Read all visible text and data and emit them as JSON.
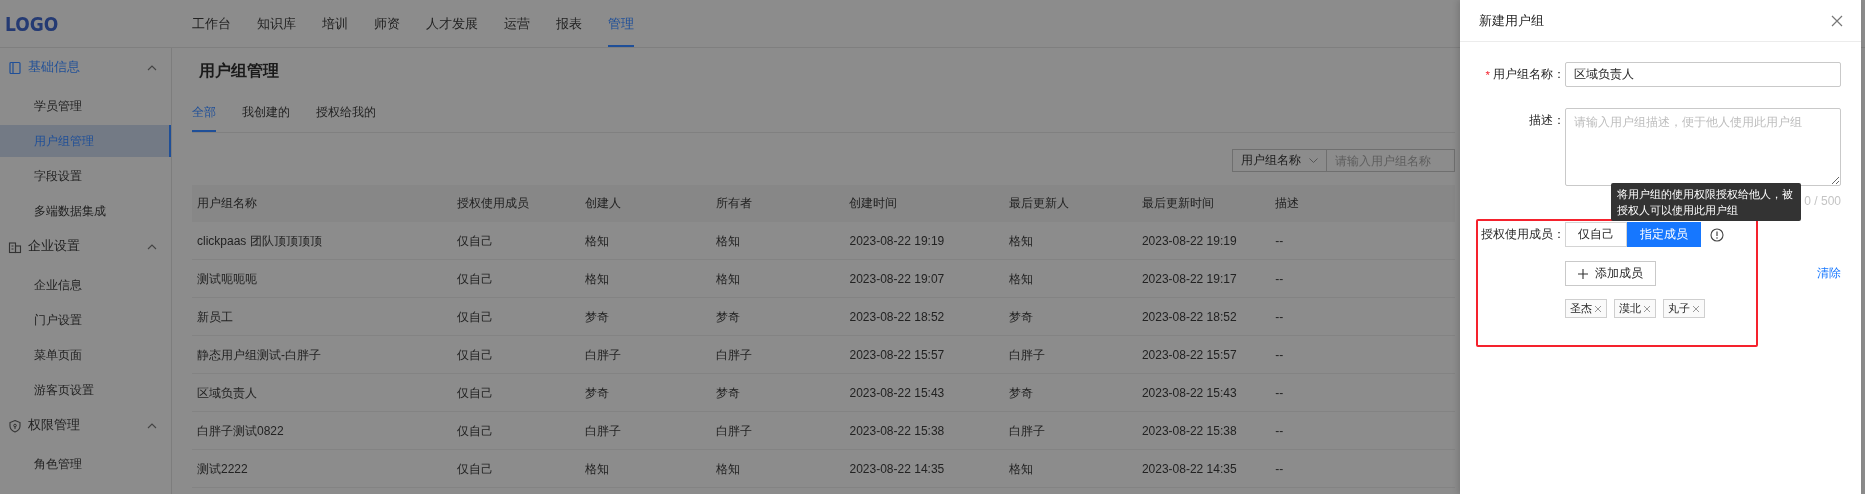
{
  "header": {
    "logo": "LOGO",
    "nav": [
      {
        "label": "工作台",
        "selected": false
      },
      {
        "label": "知识库",
        "selected": false
      },
      {
        "label": "培训",
        "selected": false
      },
      {
        "label": "师资",
        "selected": false
      },
      {
        "label": "人才发展",
        "selected": false
      },
      {
        "label": "运营",
        "selected": false
      },
      {
        "label": "报表",
        "selected": false
      },
      {
        "label": "管理",
        "selected": true
      }
    ]
  },
  "sidebar": {
    "groups": [
      {
        "label": "基础信息",
        "kind": "book",
        "active": true,
        "expanded": true,
        "children": [
          {
            "label": "学员管理",
            "selected": false
          },
          {
            "label": "用户组管理",
            "selected": true
          },
          {
            "label": "字段设置",
            "selected": false
          },
          {
            "label": "多端数据集成",
            "selected": false
          }
        ]
      },
      {
        "label": "企业设置",
        "kind": "building",
        "active": false,
        "expanded": true,
        "children": [
          {
            "label": "企业信息",
            "selected": false
          },
          {
            "label": "门户设置",
            "selected": false
          },
          {
            "label": "菜单页面",
            "selected": false
          },
          {
            "label": "游客页设置",
            "selected": false
          }
        ]
      },
      {
        "label": "权限管理",
        "kind": "shield",
        "active": false,
        "expanded": true,
        "children": [
          {
            "label": "角色管理",
            "selected": false
          }
        ]
      }
    ]
  },
  "page": {
    "title": "用户组管理",
    "tabs": [
      {
        "label": "全部",
        "selected": true
      },
      {
        "label": "我创建的",
        "selected": false
      },
      {
        "label": "授权给我的",
        "selected": false
      }
    ],
    "filter": {
      "field": "用户组名称",
      "placeholder": "请输入用户组名称"
    },
    "table": {
      "columns": [
        "用户组名称",
        "授权使用成员",
        "创建人",
        "所有者",
        "创建时间",
        "最后更新人",
        "最后更新时间",
        "描述"
      ],
      "rows": [
        [
          "clickpaas 团队顶顶顶顶",
          "仅自己",
          "格知",
          "格知",
          "2023-08-22 19:19",
          "格知",
          "2023-08-22 19:19",
          "--"
        ],
        [
          "测试呃呃呃",
          "仅自己",
          "格知",
          "格知",
          "2023-08-22 19:07",
          "格知",
          "2023-08-22 19:17",
          "--"
        ],
        [
          "新员工",
          "仅自己",
          "梦奇",
          "梦奇",
          "2023-08-22 18:52",
          "梦奇",
          "2023-08-22 18:52",
          "--"
        ],
        [
          "静态用户组测试-白胖子",
          "仅自己",
          "白胖子",
          "白胖子",
          "2023-08-22 15:57",
          "白胖子",
          "2023-08-22 15:57",
          "--"
        ],
        [
          "区域负责人",
          "仅自己",
          "梦奇",
          "梦奇",
          "2023-08-22 15:43",
          "梦奇",
          "2023-08-22 15:43",
          "--"
        ],
        [
          "白胖子测试0822",
          "仅自己",
          "白胖子",
          "白胖子",
          "2023-08-22 15:38",
          "白胖子",
          "2023-08-22 15:38",
          "--"
        ],
        [
          "测试2222",
          "仅自己",
          "格知",
          "格知",
          "2023-08-22 14:35",
          "格知",
          "2023-08-22 14:35",
          "--"
        ]
      ]
    }
  },
  "drawer": {
    "title": "新建用户组",
    "name_label": "用户组名称：",
    "name_required_mark": "*",
    "name_value": "区域负责人",
    "desc_label": "描述：",
    "desc_placeholder": "请输入用户组描述，便于他人使用此用户组",
    "counter": "0 / 500",
    "tooltip": "将用户组的使用权限授权给他人，被授权人可以使用此用户组",
    "members_label": "授权使用成员：",
    "member_modes": [
      {
        "label": "仅自己",
        "selected": false
      },
      {
        "label": "指定成员",
        "selected": true
      }
    ],
    "add_button": "添加成员",
    "clear_link": "清除",
    "members": [
      "圣杰",
      "漠北",
      "丸子"
    ]
  }
}
